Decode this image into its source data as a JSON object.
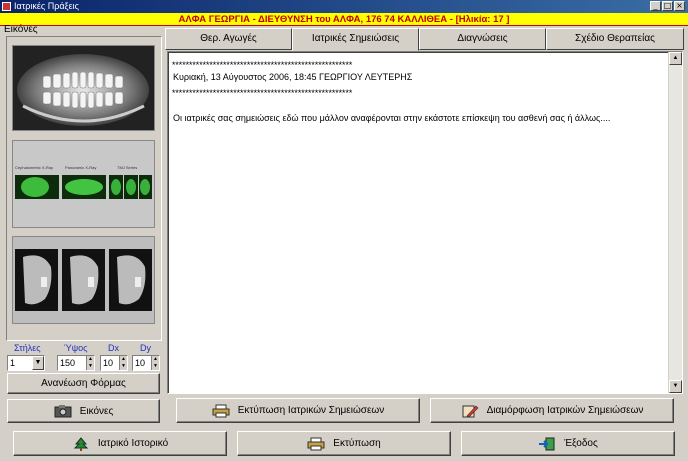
{
  "window": {
    "title": "Ιατρικές Πράξεις",
    "controls": [
      "_",
      "□",
      "×"
    ]
  },
  "patient_bar": "ΑΛΦΑ ΓΕΩΡΓΙΑ - ΔΙΕΥΘΥΝΣΗ του ΑΛΦΑ, 176 74 ΚΑΛΛΙΘΕΑ - [Ηλικία: 17 ]",
  "left": {
    "title": "Εικόνες",
    "thumb_labels": [
      "Cephalometric X-Ray",
      "Panoramic X-Ray",
      "TMJ Series"
    ],
    "spinners": {
      "columns_label": "Στήλες",
      "columns_value": "1",
      "height_label": "Ύψος",
      "height_value": "150",
      "dx_label": "Dx",
      "dx_value": "10",
      "dy_label": "Dy",
      "dy_value": "10"
    },
    "refresh_button": "Ανανέωση Φόρμας",
    "images_button": "Εικόνες"
  },
  "tabs": [
    "Θερ. Αγωγές",
    "Ιατρικές Σημειώσεις",
    "Διαγνώσεις",
    "Σχέδιο Θεραπείας"
  ],
  "active_tab": 1,
  "notes": {
    "separator": "*****************************************************",
    "header": "Κυριακή, 13 Αύγουστος 2006, 18:45 ΓΕΩΡΓΙΟΥ ΛΕΥΤΕΡΗΣ",
    "body": "Οι ιατρικές σας σημειώσεις εδώ που μάλλον αναφέρονται στην εκάστοτε επίσκεψη του ασθενή σας ή άλλως...."
  },
  "content_buttons": {
    "print_notes": "Εκτύπωση Ιατρικών Σημειώσεων",
    "format_notes": "Διαμόρφωση Ιατρικών Σημειώσεων"
  },
  "bottom_buttons": {
    "medical_history": "Ιατρικό Ιστορικό",
    "print": "Εκτύπωση",
    "exit": "Έξοδος"
  },
  "colors": {
    "title_bar": "#0a246a",
    "patient_bar_bg": "#ffff00",
    "patient_bar_text": "#c00000",
    "spinner_label": "#2030c0"
  }
}
